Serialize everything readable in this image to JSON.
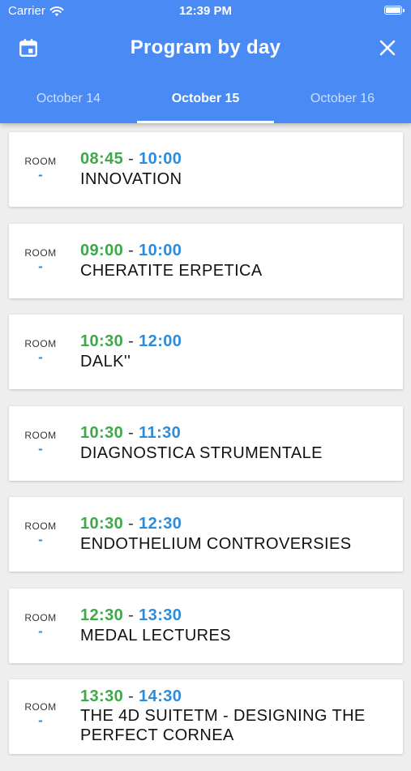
{
  "status_bar": {
    "carrier": "Carrier",
    "time": "12:39 PM"
  },
  "header": {
    "title": "Program by day",
    "left_icon": "calendar-icon",
    "right_icon": "close-icon",
    "color": "#4a8af4"
  },
  "tabs": [
    {
      "label": "October 14",
      "active": false
    },
    {
      "label": "October 15",
      "active": true
    },
    {
      "label": "October 16",
      "active": false
    }
  ],
  "colors": {
    "start_time": "#3ea84a",
    "end_time": "#2e8bd8"
  },
  "sessions": [
    {
      "room_label": "ROOM",
      "room_value": "-",
      "start": "08:45",
      "sep": "-",
      "end": "10:00",
      "title": "INNOVATION"
    },
    {
      "room_label": "ROOM",
      "room_value": "-",
      "start": "09:00",
      "sep": "-",
      "end": "10:00",
      "title": "CHERATITE ERPETICA"
    },
    {
      "room_label": "ROOM",
      "room_value": "-",
      "start": "10:30",
      "sep": "-",
      "end": "12:00",
      "title": "DALK''"
    },
    {
      "room_label": "ROOM",
      "room_value": "-",
      "start": "10:30",
      "sep": "-",
      "end": "11:30",
      "title": "DIAGNOSTICA STRUMENTALE"
    },
    {
      "room_label": "ROOM",
      "room_value": "-",
      "start": "10:30",
      "sep": "-",
      "end": "12:30",
      "title": "ENDOTHELIUM CONTROVERSIES"
    },
    {
      "room_label": "ROOM",
      "room_value": "-",
      "start": "12:30",
      "sep": "-",
      "end": "13:30",
      "title": "MEDAL LECTURES"
    },
    {
      "room_label": "ROOM",
      "room_value": "-",
      "start": "13:30",
      "sep": "-",
      "end": "14:30",
      "title": "THE 4D SUITETM -  DESIGNING THE PERFECT CORNEA"
    }
  ]
}
